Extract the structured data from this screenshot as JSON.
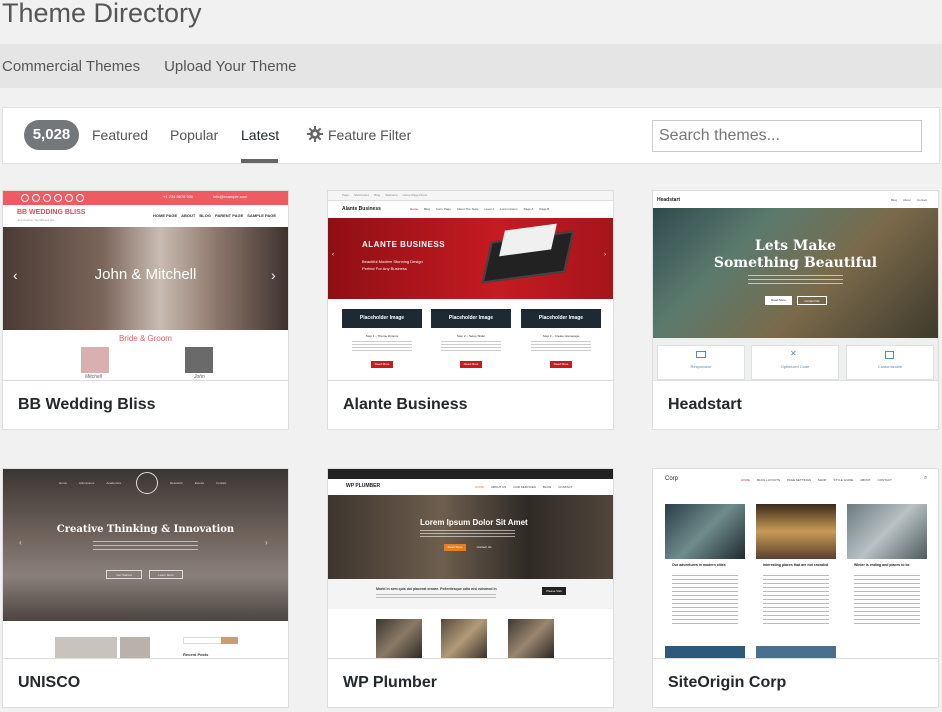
{
  "page": {
    "title": "Theme Directory"
  },
  "subnav": {
    "items": [
      "Commercial Themes",
      "Upload Your Theme"
    ]
  },
  "filters": {
    "count": "5,028",
    "tabs": [
      "Featured",
      "Popular",
      "Latest"
    ],
    "active_tab": "Latest",
    "feature_filter": "Feature Filter",
    "search_placeholder": "Search themes..."
  },
  "themes": [
    {
      "name": "BB Wedding Bliss",
      "preview": {
        "top_phone": "+1 234 5678 900",
        "top_email": "info@example.com",
        "logo": "BB WEDDING BLISS",
        "tagline": "Just another WordPress site",
        "menu": [
          "HOME PAGE",
          "ABOUT",
          "BLOG",
          "PARENT PAGE",
          "SAMPLE PAGE"
        ],
        "hero_text": "John & Mitchell",
        "section_title": "Bride & Groom",
        "bride": "Mitchell",
        "groom": "John"
      }
    },
    {
      "name": "Alante Business",
      "preview": {
        "top_links": [
          "Page",
          "Shortcodes",
          "Blog",
          "Welcome",
          "Home Page Demo"
        ],
        "logo": "Alante Business",
        "menu": [
          "Home",
          "Blog",
          "Form Page",
          "About The Tests",
          "Level 1",
          "Lorem Ipsum",
          "Page A",
          "Page B"
        ],
        "hero_title": "ALANTE BUSINESS",
        "hero_sub1": "Beautiful Modern Stunning Design",
        "hero_sub2": "Perfect For Any Business",
        "boxes": [
          {
            "title": "Placeholder Image",
            "step": "Step 1 – Theme Options"
          },
          {
            "title": "Placeholder Image",
            "step": "Step 2 – Setup Slider"
          },
          {
            "title": "Placeholder Image",
            "step": "Step 3 – Create Homepage"
          }
        ],
        "read_more": "Read More"
      }
    },
    {
      "name": "Headstart",
      "preview": {
        "logo": "Headstart",
        "menu": [
          "Blog",
          "About",
          "Contact"
        ],
        "hero_line1": "Lets Make",
        "hero_line2": "Something Beautiful",
        "hero_buttons": [
          "Read More",
          "Contact Me"
        ],
        "features": [
          "Responsive",
          "Optimized Code",
          "Customizable"
        ]
      }
    },
    {
      "name": "UNISCO",
      "preview": {
        "menu": [
          "Home",
          "Admissions",
          "Academics",
          "Research",
          "Events",
          "Contact"
        ],
        "hero_title": "Creative Thinking & Innovation",
        "hero_buttons": [
          "Get Started",
          "Learn More"
        ],
        "sidebar_title": "Recent Posts"
      }
    },
    {
      "name": "WP Plumber",
      "preview": {
        "logo": "WP PLUMBER",
        "menu": [
          "HOME",
          "ABOUT US",
          "OUR SERVICES",
          "BLOG",
          "CONTACT"
        ],
        "hero_title": "Lorem Ipsum Dolor Sit Amet",
        "hero_buttons": [
          "Read More",
          "Contact Us"
        ],
        "strip_text": "Morbi in sem quis dui placerat ornare. Pellentesque odio nisi euismod in",
        "strip_button": "Please Visit"
      }
    },
    {
      "name": "SiteOrigin Corp",
      "preview": {
        "logo": "Corp",
        "menu": [
          "HOME",
          "BLOG LAYOUTS",
          "PAGE SETTINGS",
          "SHOP",
          "STYLE GUIDE",
          "ABOUT",
          "CONTACT"
        ],
        "posts": [
          "Our adventures in modern cities",
          "Interesting places that are not crowded",
          "Winter is ending and places to be"
        ]
      }
    }
  ]
}
